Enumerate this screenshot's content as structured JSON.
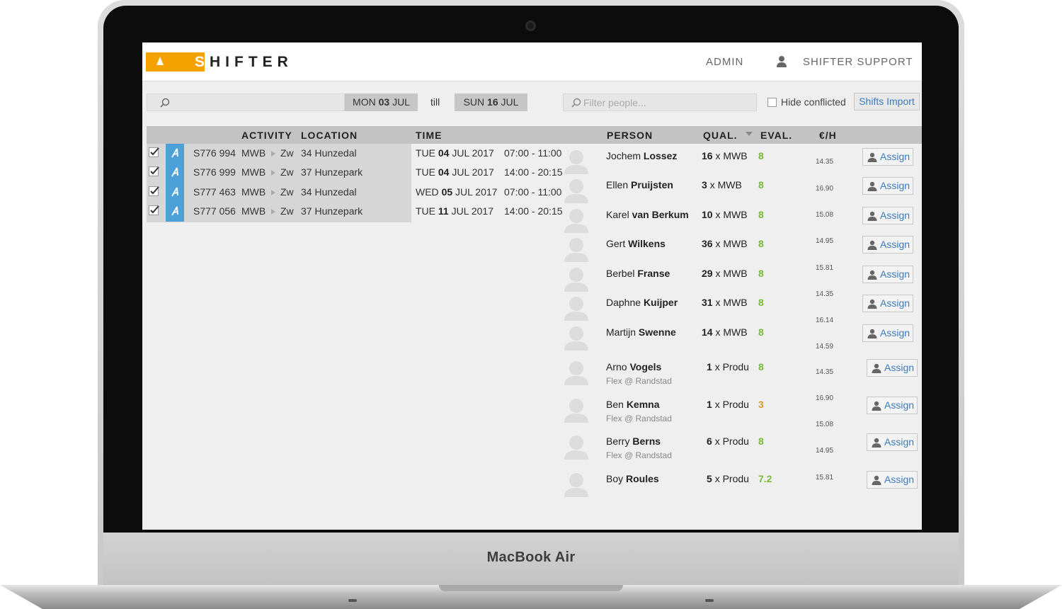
{
  "device": {
    "brand": "MacBook Air"
  },
  "topbar": {
    "logo_s": "S",
    "logo_rest": "HIFTER",
    "admin": "ADMIN",
    "support": "SHIFTER SUPPORT"
  },
  "filters": {
    "date_from_day": "MON",
    "date_from_num": "03",
    "date_from_month": "JUL",
    "till": "till",
    "date_to_day": "SUN",
    "date_to_num": "16",
    "date_to_month": "JUL",
    "filter_people_placeholder": "Filter people...",
    "hide_conflicted": "Hide conflicted",
    "shifts_import": "Shifts Import"
  },
  "headers": {
    "activity": "ACTIVITY",
    "location": "LOCATION",
    "time": "TIME",
    "person": "PERSON",
    "qual": "QUAL.",
    "eval": "EVAL.",
    "rate": "€/H"
  },
  "shifts": [
    {
      "id": "S776 994",
      "activity": "MWB",
      "zone": "Zw",
      "location": "34 Hunzedal",
      "day": "TUE",
      "date": "04",
      "monthyear": "JUL 2017",
      "time": "07:00 - 11:00"
    },
    {
      "id": "S776 999",
      "activity": "MWB",
      "zone": "Zw",
      "location": "37 Hunzepark",
      "day": "TUE",
      "date": "04",
      "monthyear": "JUL 2017",
      "time": "14:00 - 20:15"
    },
    {
      "id": "S777 463",
      "activity": "MWB",
      "zone": "Zw",
      "location": "34 Hunzedal",
      "day": "WED",
      "date": "05",
      "monthyear": "JUL 2017",
      "time": "07:00 - 11:00"
    },
    {
      "id": "S777 056",
      "activity": "MWB",
      "zone": "Zw",
      "location": "37 Hunzepark",
      "day": "TUE",
      "date": "11",
      "monthyear": "JUL 2017",
      "time": "14:00 - 20:15"
    }
  ],
  "people": [
    {
      "first": "Jochem",
      "last": "Lossez",
      "sub": "",
      "qual_num": "16",
      "qual_type": "x MWB",
      "eval": "8",
      "assign": "Assign"
    },
    {
      "first": "Ellen",
      "last": "Pruijsten",
      "sub": "",
      "qual_num": "3",
      "qual_type": "x MWB",
      "eval": "8",
      "assign": "Assign"
    },
    {
      "first": "Karel",
      "last": "van Berkum",
      "sub": "",
      "qual_num": "10",
      "qual_type": "x MWB",
      "eval": "8",
      "assign": "Assign"
    },
    {
      "first": "Gert",
      "last": "Wilkens",
      "sub": "",
      "qual_num": "36",
      "qual_type": "x MWB",
      "eval": "8",
      "assign": "Assign"
    },
    {
      "first": "Berbel",
      "last": "Franse",
      "sub": "",
      "qual_num": "29",
      "qual_type": "x MWB",
      "eval": "8",
      "assign": "Assign"
    },
    {
      "first": "Daphne",
      "last": "Kuijper",
      "sub": "",
      "qual_num": "31",
      "qual_type": "x MWB",
      "eval": "8",
      "assign": "Assign"
    },
    {
      "first": "Martijn",
      "last": "Swenne",
      "sub": "",
      "qual_num": "14",
      "qual_type": "x MWB",
      "eval": "8",
      "assign": "Assign"
    },
    {
      "first": "Arno",
      "last": "Vogels",
      "sub": "Flex @ Randstad",
      "qual_num": "1",
      "qual_type": "x Produ",
      "eval": "8",
      "assign": "Assign"
    },
    {
      "first": "Ben",
      "last": "Kemna",
      "sub": "Flex @ Randstad",
      "qual_num": "1",
      "qual_type": "x Produ",
      "eval": "3",
      "assign": "Assign"
    },
    {
      "first": "Berry",
      "last": "Berns",
      "sub": "Flex @ Randstad",
      "qual_num": "6",
      "qual_type": "x Produ",
      "eval": "8",
      "assign": "Assign"
    },
    {
      "first": "Boy",
      "last": "Roules",
      "sub": "",
      "qual_num": "5",
      "qual_type": "x Produ",
      "eval": "7.2",
      "assign": "Assign"
    }
  ],
  "rates": [
    "14.35",
    "16.90",
    "15.08",
    "14.95",
    "15.81",
    "14.35",
    "16.14",
    "14.59",
    "14.35",
    "16.90",
    "15.08",
    "14.95",
    "15.81"
  ],
  "colors": {
    "accent": "#f5a100",
    "tag": "#4ea0d8",
    "eval_good": "#7ab83a",
    "eval_warn": "#d29a2d",
    "link": "#3a7bbf"
  }
}
